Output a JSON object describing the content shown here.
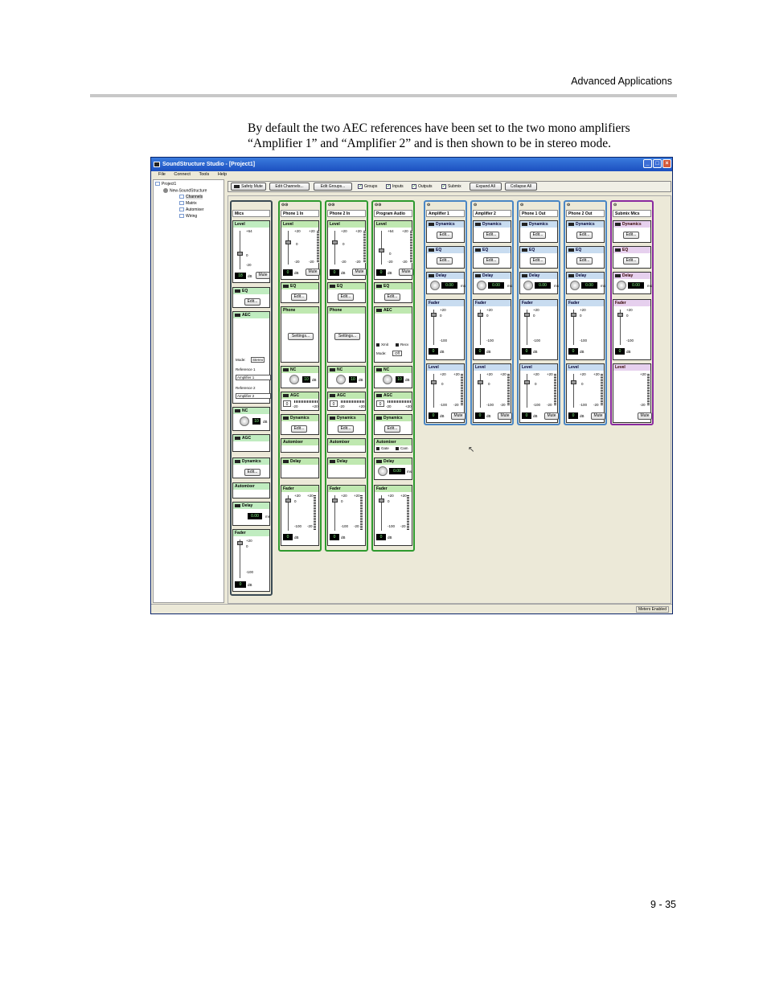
{
  "header": {
    "section": "Advanced Applications"
  },
  "intro": "By default the two AEC references have been set to the two mono amplifiers “Amplifier 1” and “Amplifier 2” and is then shown to be in stereo mode.",
  "page_number": "9 - 35",
  "app": {
    "title": "SoundStructure Studio - [Project1]",
    "menu": [
      "File",
      "Connect",
      "Tools",
      "Help"
    ],
    "tree": {
      "project": "Project1",
      "device": "New-SoundStructure",
      "items": [
        "Channels",
        "Matrix",
        "Automixer",
        "Wiring"
      ]
    },
    "toolbar": {
      "safety_mute": "Safety Mute",
      "edit_channels": "Edit Channels...",
      "edit_groups": "Edit Groups...",
      "checks": [
        "Groups",
        "Inputs",
        "Outputs",
        "Submix"
      ],
      "expand_all": "Expand All",
      "collapse_all": "Collapse All"
    },
    "labels": {
      "level": "Level",
      "eq": "EQ",
      "edit": "Edit...",
      "aec": "AEC",
      "phone": "Phone",
      "settings": "Settings...",
      "nc": "NC",
      "agc": "AGC",
      "dynamics": "Dynamics",
      "automixer": "Automixer",
      "delay": "Delay",
      "fader": "Fader",
      "mute": "Mute",
      "db": "dB",
      "ms": "ms",
      "mode": "Mode:",
      "stereo": "Stereo",
      "off": "Off",
      "reference1": "Reference 1",
      "reference2": "Reference 2",
      "amplifier1": "Amplifier 1",
      "amplifier2": "Amplifier 2",
      "xmit": "Xmit",
      "recv": "Recv",
      "gate": "Gate",
      "cam": "Cam",
      "p20": "+20",
      "p64": "+64",
      "zero": "0",
      "m20": "-20",
      "m100": "-100",
      "val0": "0",
      "val10": "10",
      "val18": "18",
      "delay_val": "0.00"
    },
    "strips": [
      {
        "name": "Mics",
        "type": "group"
      },
      {
        "name": "Phone 1 In",
        "type": "input"
      },
      {
        "name": "Phone 2 In",
        "type": "input"
      },
      {
        "name": "Program Audio",
        "type": "input"
      },
      {
        "name": "Amplifier 1",
        "type": "output"
      },
      {
        "name": "Amplifier 2",
        "type": "output"
      },
      {
        "name": "Phone 1 Out",
        "type": "output"
      },
      {
        "name": "Phone 2 Out",
        "type": "output"
      },
      {
        "name": "Submix Mics",
        "type": "submix"
      }
    ],
    "status": "Meters Enabled",
    "colors": {
      "input": "#2e9a2e",
      "output": "#4a86c4",
      "submix": "#8a2aa0",
      "group": "#3a4a54"
    }
  }
}
